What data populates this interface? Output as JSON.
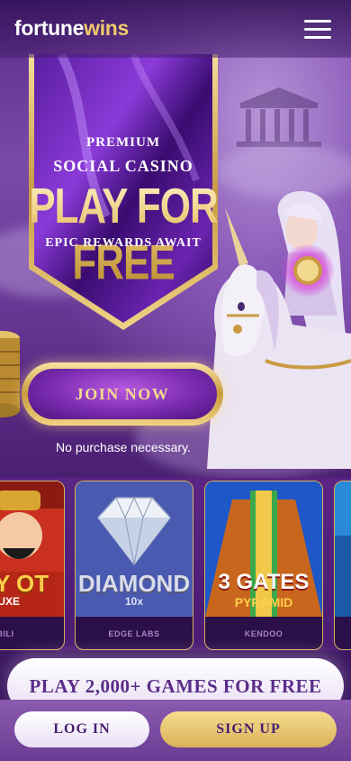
{
  "header": {
    "logo_part1": "fortune",
    "logo_part2": "wins",
    "menu_icon": "hamburger-menu-icon"
  },
  "hero": {
    "premium": "PREMIUM",
    "social_casino": "SOCIAL CASINO",
    "play_for_free": "PLAY FOR FREE",
    "epic_rewards": "EPIC REWARDS AWAIT",
    "join_button": "JOIN NOW",
    "no_purchase": "No purchase necessary."
  },
  "games": [
    {
      "title": "NEY OT",
      "subtitle": "LUXE",
      "provider": "BILI"
    },
    {
      "title": "DIAMOND",
      "subtitle": "10x",
      "provider": "EDGE LABS"
    },
    {
      "title": "3 GATES",
      "subtitle": "PYRAMID",
      "provider": "KENDOO"
    }
  ],
  "promo": {
    "label": "PLAY 2,000+ GAMES FOR FREE"
  },
  "footer": {
    "login": "LOG IN",
    "signup": "SIGN UP"
  },
  "colors": {
    "background": "#3b1660",
    "gold": "#e6c26b",
    "purple_dark": "#4a1f72"
  }
}
